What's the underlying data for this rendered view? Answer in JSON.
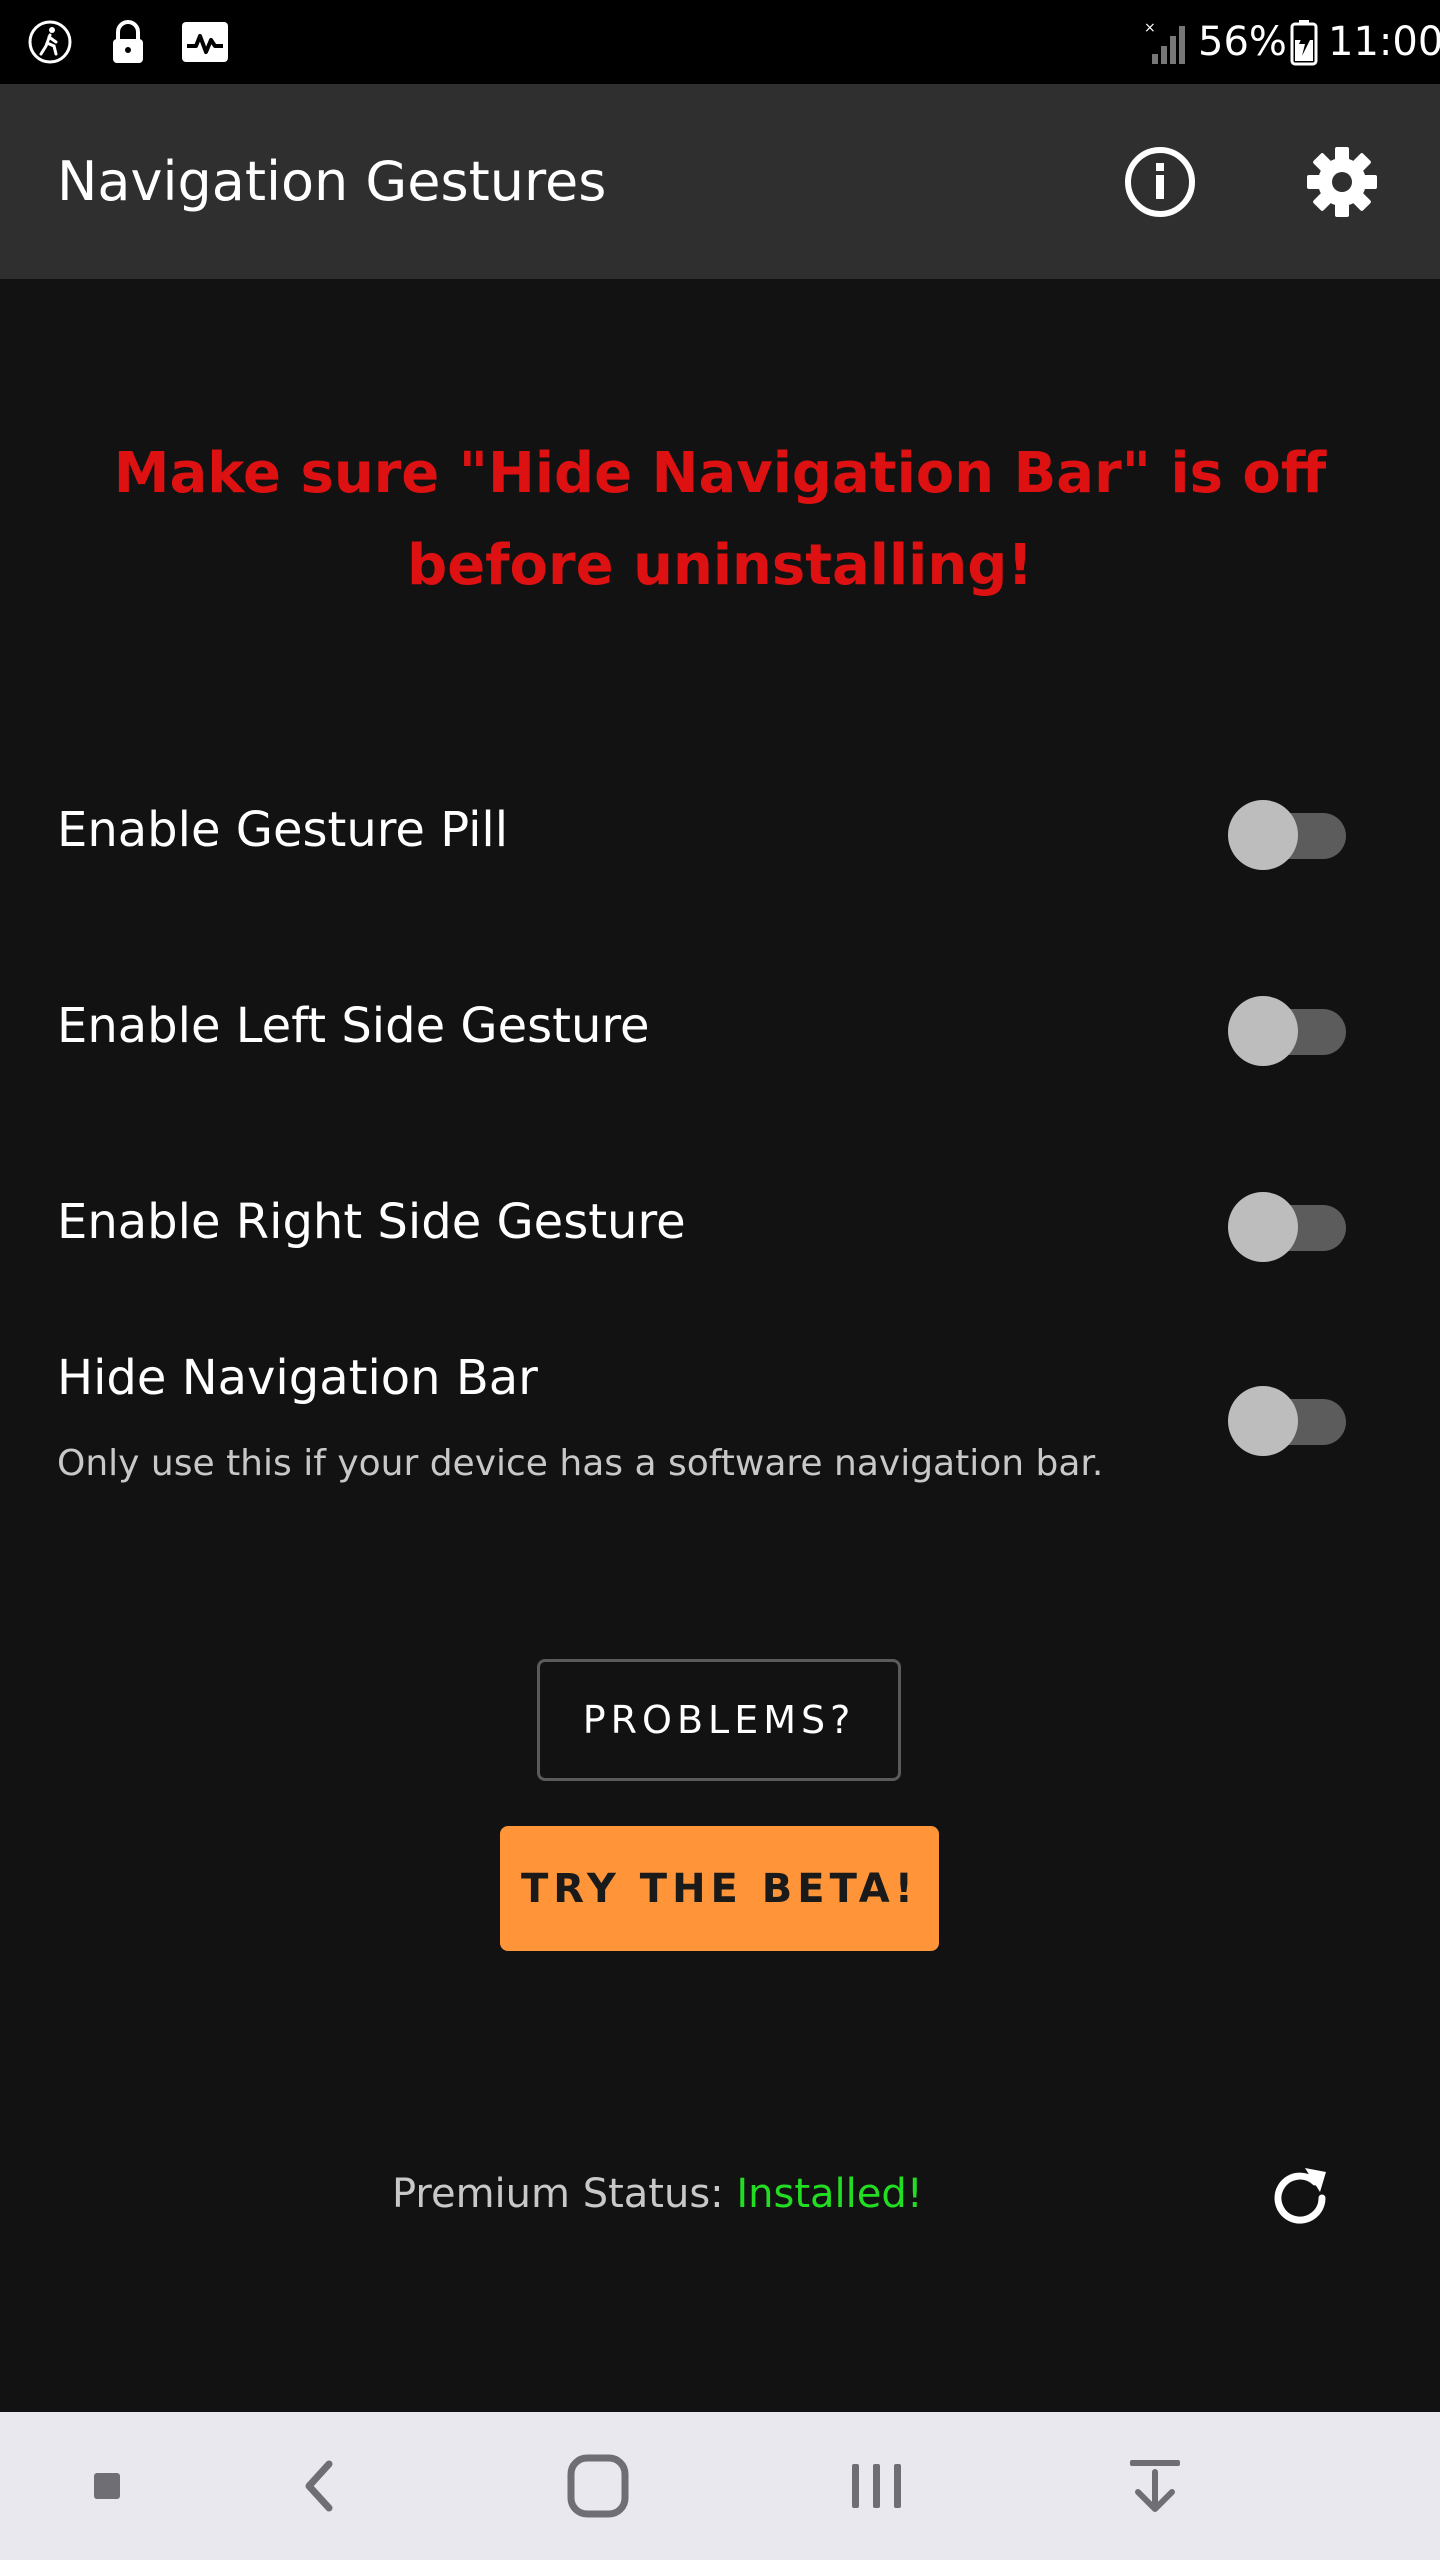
{
  "status_bar": {
    "battery": "56%",
    "time": "11:00",
    "icons": [
      "walk-icon",
      "lock-icon",
      "activity-icon",
      "signal-icon",
      "battery-charging-icon"
    ]
  },
  "app_bar": {
    "title": "Navigation Gestures",
    "actions": [
      "info-icon",
      "settings-icon"
    ]
  },
  "warning": "Make sure \"Hide Navigation Bar\" is off before uninstalling!",
  "settings": [
    {
      "label": "Enable Gesture Pill",
      "enabled": false
    },
    {
      "label": "Enable Left Side Gesture",
      "enabled": false
    },
    {
      "label": "Enable Right Side Gesture",
      "enabled": false
    },
    {
      "label": "Hide Navigation Bar",
      "sublabel": "Only use this if your device has a software navigation bar.",
      "enabled": false
    }
  ],
  "buttons": {
    "problems": "PROBLEMS?",
    "beta": "TRY THE BETA!"
  },
  "premium": {
    "label": "Premium Status:",
    "value": "Installed!"
  },
  "nav_bar": [
    "square-icon",
    "back-icon",
    "home-icon",
    "recents-icon",
    "download-icon"
  ],
  "colors": {
    "warning": "#dd1111",
    "beta_button": "#ff9538",
    "premium_value": "#22dd22",
    "background": "#121212",
    "app_bar": "#2f2f2f"
  }
}
